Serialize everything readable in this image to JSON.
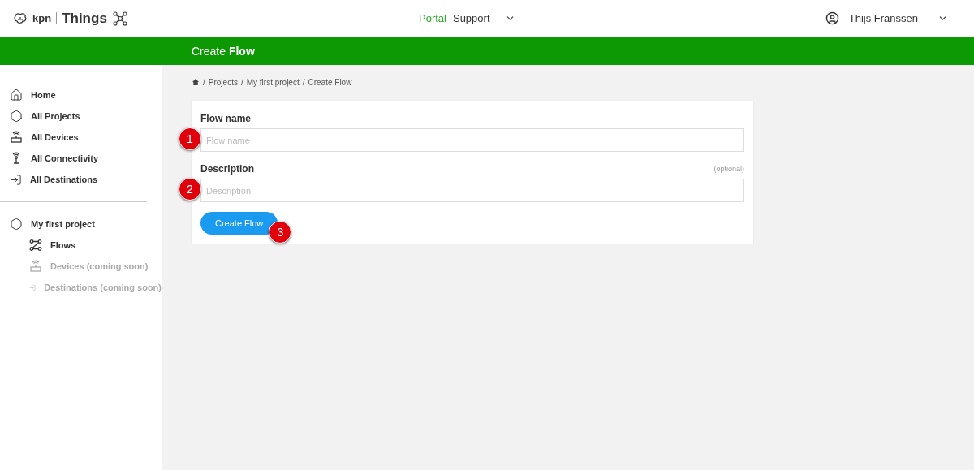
{
  "header": {
    "brand": "kpn",
    "product": "Things",
    "nav": [
      {
        "label": "Portal",
        "selected": true
      },
      {
        "label": "Support",
        "selected": false
      }
    ],
    "user": "Thijs Franssen"
  },
  "title_bar": {
    "title": "Create **Flow**"
  },
  "sidebar": {
    "items": [
      {
        "label": "Home",
        "disabled": false
      },
      {
        "label": "All Projects",
        "disabled": false
      },
      {
        "label": "All Devices",
        "disabled": false
      },
      {
        "label": "All Connectivity",
        "disabled": false
      },
      {
        "label": "All Destinations",
        "disabled": false
      }
    ],
    "project": {
      "label": "My first project",
      "children": [
        {
          "label": "Flows",
          "disabled": false
        },
        {
          "label": "Devices (coming soon)",
          "disabled": true
        },
        {
          "label": "Destinations (coming soon)",
          "disabled": true
        }
      ]
    }
  },
  "breadcrumb": [
    {
      "separator": "/",
      "label": "Projects"
    },
    {
      "separator": "/",
      "label": "My first project"
    },
    {
      "separator": "/",
      "label": "Create Flow"
    }
  ],
  "form": {
    "fields": [
      {
        "label": "Flow name",
        "placeholder": "Flow name",
        "badge": "1"
      },
      {
        "label": "Description",
        "placeholder": "Description",
        "hint": "(optional)",
        "badge": "2"
      }
    ],
    "submit": {
      "label": "Create Flow",
      "badge": "3"
    }
  }
}
